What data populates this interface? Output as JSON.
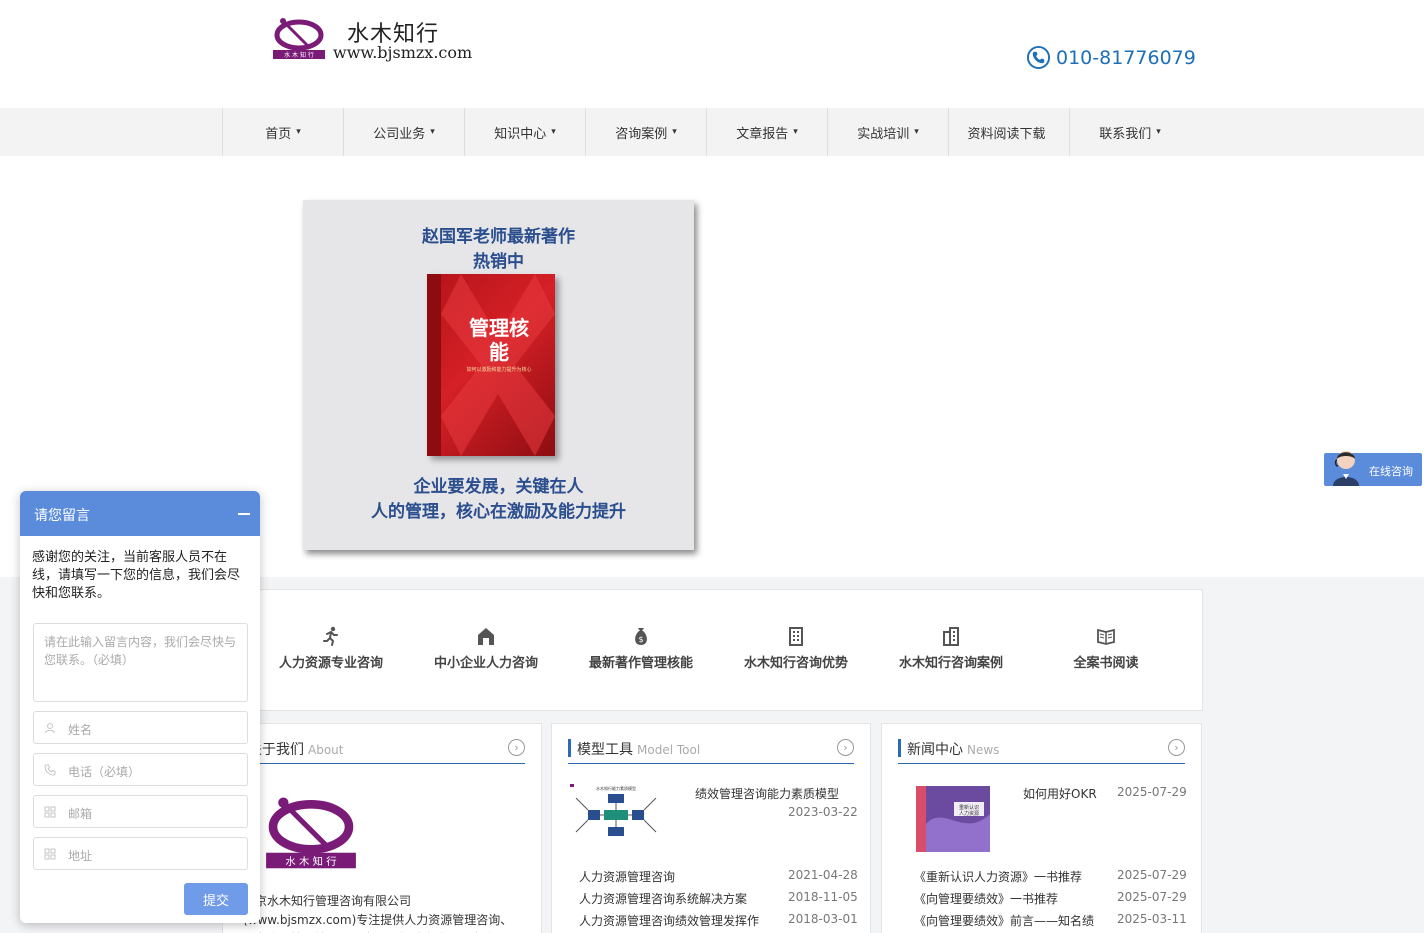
{
  "header": {
    "brand_name": "水木知行",
    "brand_url": "www.bjsmzx.com",
    "logo_icon": "brand-logo-icon",
    "phone": "010-81776079",
    "accent_color": "#1e6fb8"
  },
  "nav": {
    "items": [
      {
        "label": "首页",
        "caret": "▾"
      },
      {
        "label": "公司业务",
        "caret": "▾"
      },
      {
        "label": "知识中心",
        "caret": "▾"
      },
      {
        "label": "咨询案例",
        "caret": "▾"
      },
      {
        "label": "文章报告",
        "caret": "▾"
      },
      {
        "label": "实战培训",
        "caret": "▾"
      },
      {
        "label": "资料阅读下载",
        "caret": ""
      },
      {
        "label": "联系我们",
        "caret": "▾"
      }
    ]
  },
  "banner": {
    "headline1": "赵国军老师最新著作",
    "headline2": "热销中",
    "book_title": "管理核能",
    "book_subtitle": "如何以激励和能力提升为核心",
    "footline1": "企业要发展，关键在人",
    "footline2": "人的管理，核心在激励及能力提升",
    "text_color": "#2b4e8e"
  },
  "services": [
    {
      "label": "人力资源专业咨询",
      "icon": "running-person-icon"
    },
    {
      "label": "中小企业人力咨询",
      "icon": "house-icon"
    },
    {
      "label": "最新著作管理核能",
      "icon": "money-bag-icon"
    },
    {
      "label": "水木知行咨询优势",
      "icon": "building-icon"
    },
    {
      "label": "水木知行咨询案例",
      "icon": "building-icon"
    },
    {
      "label": "全案书阅读",
      "icon": "open-book-icon"
    }
  ],
  "about": {
    "title": "关于我们",
    "title_en": "About",
    "text": "北京水木知行管理咨询有限公司(www.bjsmzx.com)专注提供人力资源管理咨询、人力资源管理培训、人力资源招聘咨询、人力资源猎头"
  },
  "model_tool": {
    "title": "模型工具",
    "title_en": "Model Tool",
    "featured": {
      "title": "绩效管理咨询能力素质模型",
      "date": "2023-03-22"
    },
    "items": [
      {
        "title": "人力资源管理咨询",
        "date": "2021-04-28"
      },
      {
        "title": "人力资源管理咨询系统解决方案",
        "date": "2018-11-05"
      },
      {
        "title": "人力资源管理咨询绩效管理发挥作",
        "date": "2018-03-01"
      }
    ]
  },
  "news": {
    "title": "新闻中心",
    "title_en": "News",
    "featured": {
      "title": "如何用好OKR",
      "date": "2025-07-29"
    },
    "items": [
      {
        "title": "《重新认识人力资源》一书推荐",
        "date": "2025-07-29"
      },
      {
        "title": "《向管理要绩效》一书推荐",
        "date": "2025-07-29"
      },
      {
        "title": "《向管理要绩效》前言——知名绩",
        "date": "2025-03-11"
      }
    ]
  },
  "consult": {
    "label": "在线咨询"
  },
  "message": {
    "title": "请您留言",
    "intro": "感谢您的关注，当前客服人员不在线，请填写一下您的信息，我们会尽快和您联系。",
    "content_placeholder": "请在此输入留言内容，我们会尽快与您联系。（必填）",
    "fields": [
      {
        "placeholder": "姓名",
        "icon": "person-icon"
      },
      {
        "placeholder": "电话（必填）",
        "icon": "phone-icon"
      },
      {
        "placeholder": "邮箱",
        "icon": "grid-icon"
      },
      {
        "placeholder": "地址",
        "icon": "grid-icon"
      }
    ],
    "submit": "提交",
    "accent_color": "#5b8cdc"
  }
}
